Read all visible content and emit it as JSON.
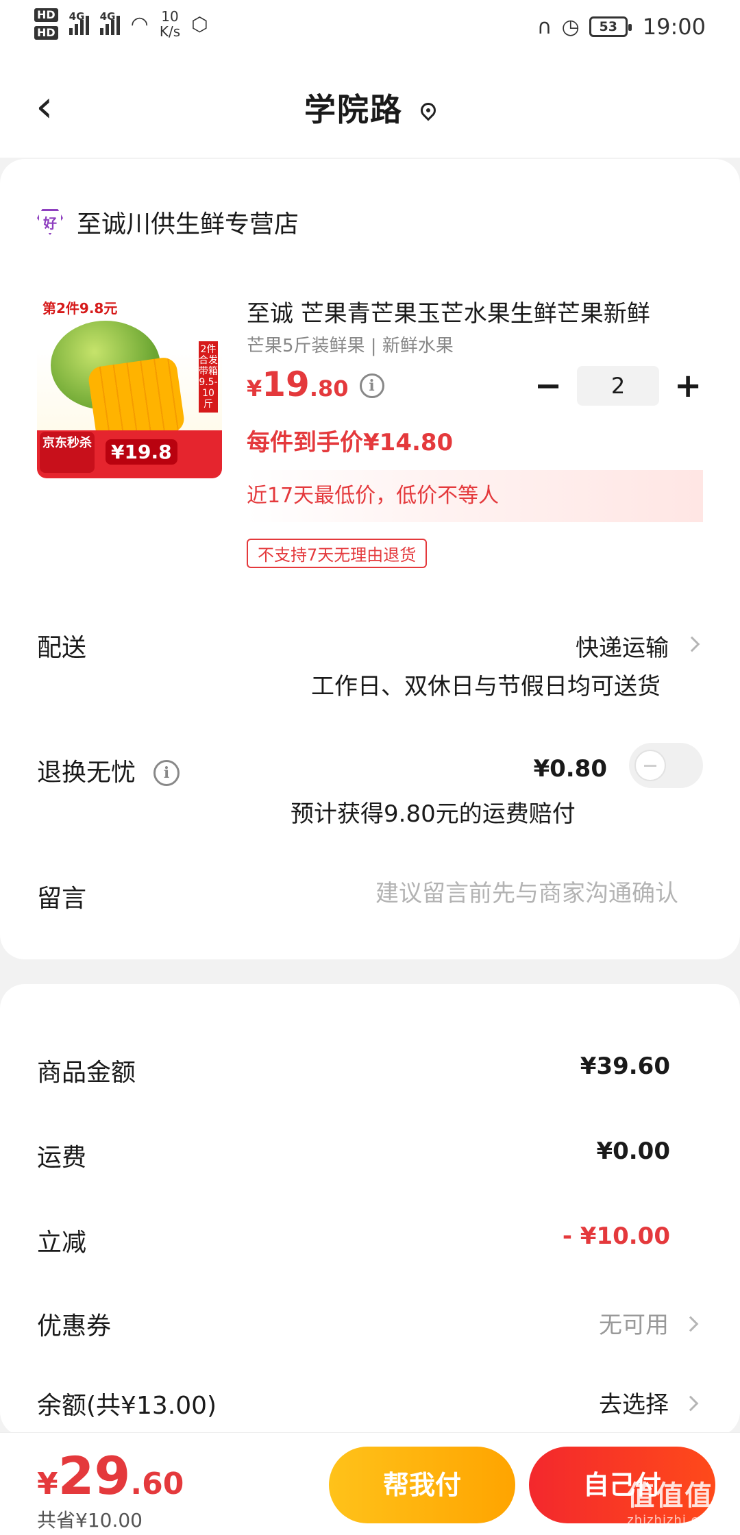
{
  "status_bar": {
    "hd1": "HD",
    "hd2": "HD",
    "net1": "4G",
    "net2": "4G",
    "speed_value": "10",
    "speed_unit": "K/s",
    "battery": "53",
    "time": "19:00"
  },
  "nav": {
    "title": "学院路"
  },
  "shop": {
    "icon_text": "好",
    "name": "至诚川供生鲜专营店"
  },
  "product": {
    "image_promo": "第2件9.8元",
    "image_badge": "京东秒杀",
    "image_price": "¥19.8",
    "image_side": "2件合发带箱9.5-10斤",
    "title": "至诚 芒果青芒果玉芒水果生鲜芒果新鲜",
    "spec": "芒果5斤装鲜果 | 新鲜水果",
    "price_symbol": "¥",
    "price_int": "19",
    "price_dec": ".80",
    "quantity": "2",
    "hand_price": "每件到手价¥14.80",
    "lowest_note": "近17天最低价，低价不等人",
    "no_return_tag": "不支持7天无理由退货"
  },
  "delivery": {
    "label": "配送",
    "value": "快递运输",
    "desc": "工作日、双休日与节假日均可送货"
  },
  "return_insurance": {
    "label": "退换无忧",
    "price": "¥0.80",
    "desc": "预计获得9.80元的运费赔付",
    "enabled": false
  },
  "message": {
    "label": "留言",
    "placeholder": "建议留言前先与商家沟通确认"
  },
  "summary": {
    "goods_label": "商品金额",
    "goods_value": "¥39.60",
    "shipping_label": "运费",
    "shipping_value": "¥0.00",
    "discount_label": "立减",
    "discount_value": "- ¥10.00",
    "coupon_label": "优惠券",
    "coupon_value": "无可用",
    "balance_label": "余额(共¥13.00)",
    "balance_value": "去选择"
  },
  "bottom": {
    "total_symbol": "¥",
    "total_int": "29",
    "total_dec": ".60",
    "saved": "共省¥10.00",
    "help_pay_label": "帮我付",
    "self_pay_label": "自己付"
  },
  "watermark": {
    "text": "值值值",
    "domain": "zhizhizhi.com"
  },
  "colors": {
    "accent_red": "#e4393c",
    "help_button": "#ffb300",
    "self_button": "#f3282d"
  }
}
